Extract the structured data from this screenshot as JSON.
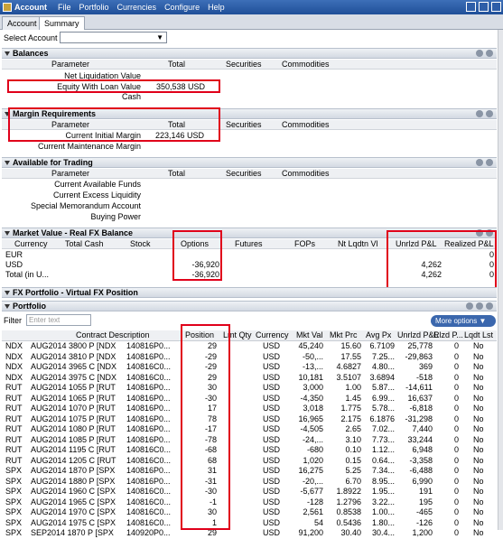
{
  "menu": {
    "items": [
      "Account",
      "File",
      "Portfolio",
      "Currencies",
      "Configure",
      "Help"
    ]
  },
  "tabs": [
    "Account",
    "Summary"
  ],
  "select_account": {
    "label": "Select Account",
    "value": ""
  },
  "balances": {
    "title": "Balances",
    "headers": [
      "Parameter",
      "Total",
      "Securities",
      "Commodities"
    ],
    "rows": [
      {
        "p": "Net Liquidation Value",
        "v": ""
      },
      {
        "p": "Equity With Loan Value",
        "v": "350,538 USD"
      },
      {
        "p": "Cash",
        "v": ""
      }
    ]
  },
  "margin": {
    "title": "Margin Requirements",
    "headers": [
      "Parameter",
      "Total",
      "Securities",
      "Commodities"
    ],
    "rows": [
      {
        "p": "Current Initial Margin",
        "v": "223,146 USD"
      },
      {
        "p": "Current Maintenance Margin",
        "v": ""
      }
    ]
  },
  "available": {
    "title": "Available for Trading",
    "headers": [
      "Parameter",
      "Total",
      "Securities",
      "Commodities"
    ],
    "rows": [
      "Current Available Funds",
      "Current Excess Liquidity",
      "Special Memorandum Account",
      "Buying Power"
    ]
  },
  "market": {
    "title": "Market Value - Real FX Balance",
    "headers": [
      "Currency",
      "Total Cash",
      "Stock",
      "Options",
      "Futures",
      "FOPs",
      "Nt Lqdtn Vl",
      "Unrlzd P&L",
      "Realized P&L"
    ],
    "rows": [
      {
        "cur": "EUR",
        "opt": "",
        "unr": "",
        "rea": "0"
      },
      {
        "cur": "USD",
        "opt": "-36,920",
        "unr": "4,262",
        "rea": "0"
      },
      {
        "cur": "Total (in U...",
        "opt": "-36,920",
        "unr": "4,262",
        "rea": "0"
      }
    ]
  },
  "fx": {
    "title": "FX Portfolio - Virtual FX Position"
  },
  "portfolio": {
    "title": "Portfolio",
    "filter_label": "Filter",
    "filter_placeholder": "Enter text",
    "more_options": "More options",
    "headers": [
      "Contract Description",
      "Position",
      "Lmt Qty",
      "Currency",
      "Mkt Val",
      "Mkt Prc",
      "Avg Px",
      "Unrlzd P&L",
      "Rlzd P...",
      "Lqdt Lst"
    ],
    "rows": [
      [
        "NDX",
        "AUG2014 3800 P [NDX",
        "140816P0...",
        "29",
        "USD",
        "45,240",
        "15.60",
        "6.7109",
        "25,778",
        "0",
        "No"
      ],
      [
        "NDX",
        "AUG2014 3810 P [NDX",
        "140816P0...",
        "-29",
        "USD",
        "-50,...",
        "17.55",
        "7.25...",
        "-29,863",
        "0",
        "No"
      ],
      [
        "NDX",
        "AUG2014 3965 C [NDX",
        "140816C0...",
        "-29",
        "USD",
        "-13,...",
        "4.6827",
        "4.80...",
        "369",
        "0",
        "No"
      ],
      [
        "NDX",
        "AUG2014 3975 C [NDX",
        "140816C0...",
        "29",
        "USD",
        "10,181",
        "3.5107",
        "3.6894",
        "-518",
        "0",
        "No"
      ],
      [
        "RUT",
        "AUG2014 1055 P [RUT",
        "140816P0...",
        "30",
        "USD",
        "3,000",
        "1.00",
        "5.87...",
        "-14,611",
        "0",
        "No"
      ],
      [
        "RUT",
        "AUG2014 1065 P [RUT",
        "140816P0...",
        "-30",
        "USD",
        "-4,350",
        "1.45",
        "6.99...",
        "16,637",
        "0",
        "No"
      ],
      [
        "RUT",
        "AUG2014 1070 P [RUT",
        "140816P0...",
        "17",
        "USD",
        "3,018",
        "1.775",
        "5.78...",
        "-6,818",
        "0",
        "No"
      ],
      [
        "RUT",
        "AUG2014 1075 P [RUT",
        "140816P0...",
        "78",
        "USD",
        "16,965",
        "2.175",
        "6.1876",
        "-31,298",
        "0",
        "No"
      ],
      [
        "RUT",
        "AUG2014 1080 P [RUT",
        "140816P0...",
        "-17",
        "USD",
        "-4,505",
        "2.65",
        "7.02...",
        "7,440",
        "0",
        "No"
      ],
      [
        "RUT",
        "AUG2014 1085 P [RUT",
        "140816P0...",
        "-78",
        "USD",
        "-24,...",
        "3.10",
        "7.73...",
        "33,244",
        "0",
        "No"
      ],
      [
        "RUT",
        "AUG2014 1195 C [RUT",
        "140816C0...",
        "-68",
        "USD",
        "-680",
        "0.10",
        "1.12...",
        "6,948",
        "0",
        "No"
      ],
      [
        "RUT",
        "AUG2014 1205 C [RUT",
        "140816C0...",
        "68",
        "USD",
        "1,020",
        "0.15",
        "0.64...",
        "-3,358",
        "0",
        "No"
      ],
      [
        "SPX",
        "AUG2014 1870 P [SPX",
        "140816P0...",
        "31",
        "USD",
        "16,275",
        "5.25",
        "7.34...",
        "-6,488",
        "0",
        "No"
      ],
      [
        "SPX",
        "AUG2014 1880 P [SPX",
        "140816P0...",
        "-31",
        "USD",
        "-20,...",
        "6.70",
        "8.95...",
        "6,990",
        "0",
        "No"
      ],
      [
        "SPX",
        "AUG2014 1960 C [SPX",
        "140816C0...",
        "-30",
        "USD",
        "-5,677",
        "1.8922",
        "1.95...",
        "191",
        "0",
        "No"
      ],
      [
        "SPX",
        "AUG2014 1965 C [SPX",
        "140816C0...",
        "-1",
        "USD",
        "-128",
        "1.2796",
        "3.22...",
        "195",
        "0",
        "No"
      ],
      [
        "SPX",
        "AUG2014 1970 C [SPX",
        "140816C0...",
        "30",
        "USD",
        "2,561",
        "0.8538",
        "1.00...",
        "-465",
        "0",
        "No"
      ],
      [
        "SPX",
        "AUG2014 1975 C [SPX",
        "140816C0...",
        "1",
        "USD",
        "54",
        "0.5436",
        "1.80...",
        "-126",
        "0",
        "No"
      ],
      [
        "SPX",
        "SEP2014 1870 P [SPX",
        "140920P0...",
        "29",
        "USD",
        "91,200",
        "30.40",
        "30.4...",
        "1,200",
        "0",
        "No"
      ]
    ]
  },
  "colors": {
    "titlebar": "#2a5aa6",
    "highlight": "#e0001a",
    "more_button": "#3b67ad"
  }
}
